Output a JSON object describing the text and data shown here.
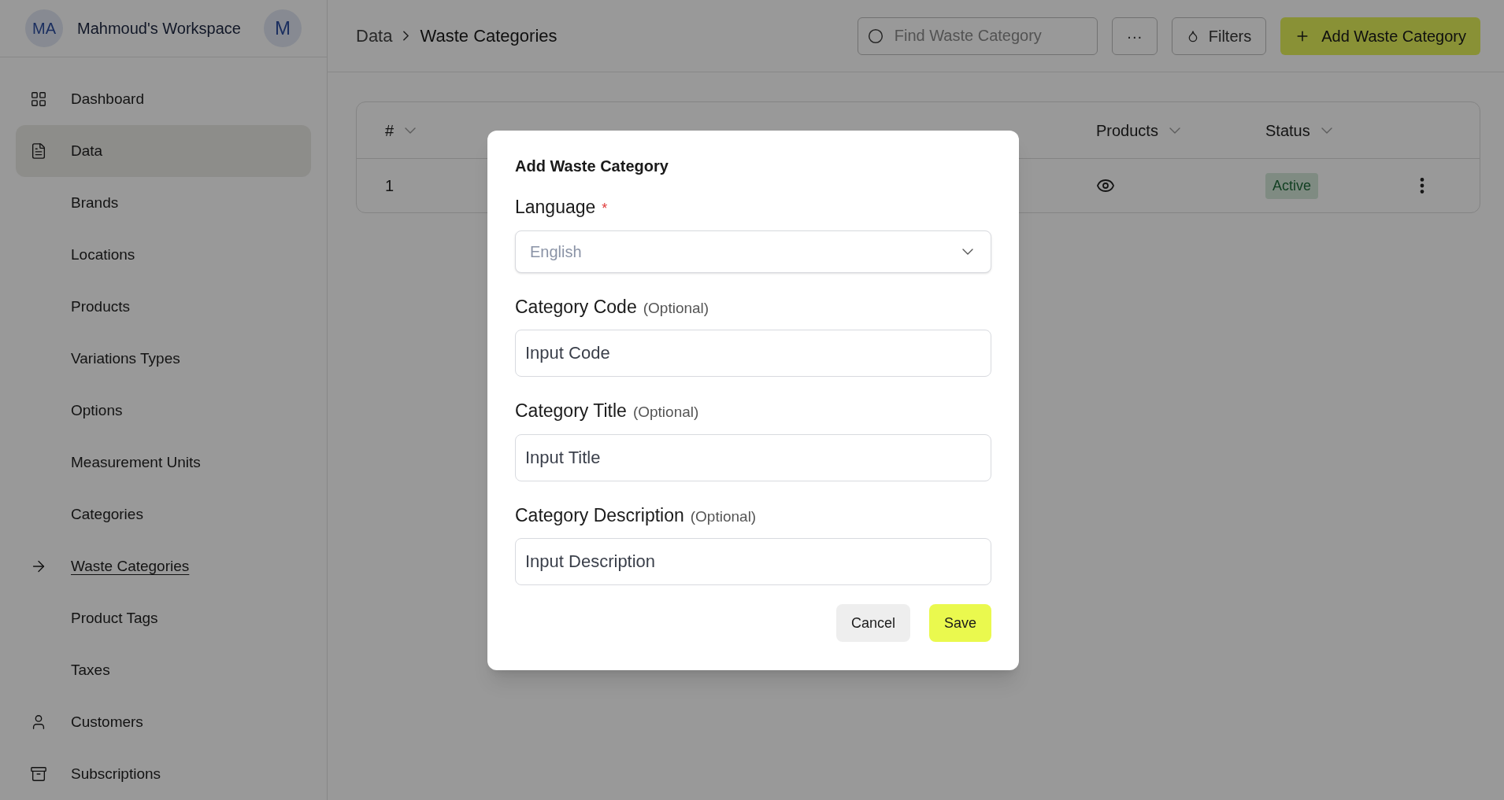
{
  "workspace": {
    "initials": "MA",
    "name": "Mahmoud's Workspace",
    "user_initial": "M"
  },
  "sidebar": {
    "items": [
      {
        "label": "Dashboard",
        "selected": false
      },
      {
        "label": "Data",
        "selected": true,
        "children": [
          {
            "label": "Brands",
            "selected": false
          },
          {
            "label": "Locations",
            "selected": false
          },
          {
            "label": "Products",
            "selected": false
          },
          {
            "label": "Variations Types",
            "selected": false
          },
          {
            "label": "Options",
            "selected": false
          },
          {
            "label": "Measurement Units",
            "selected": false
          },
          {
            "label": "Categories",
            "selected": false
          },
          {
            "label": "Waste Categories",
            "selected": true
          },
          {
            "label": "Product Tags",
            "selected": false
          },
          {
            "label": "Taxes",
            "selected": false
          }
        ]
      },
      {
        "label": "Customers",
        "selected": false
      },
      {
        "label": "Subscriptions",
        "selected": false
      }
    ]
  },
  "breadcrumb": [
    "Data",
    "Waste Categories"
  ],
  "search": {
    "placeholder": "Find Waste Category"
  },
  "toolbar": {
    "more": "···",
    "filters": "Filters",
    "add": "Add Waste Category"
  },
  "table": {
    "columns": [
      "#",
      "Products",
      "Status"
    ],
    "rows": [
      {
        "number": "1",
        "status": "Active"
      }
    ]
  },
  "dialog": {
    "title": "Add Waste Category",
    "fields": [
      {
        "kind": "select",
        "label": "Language",
        "required_mark": "*",
        "placeholder": "English"
      },
      {
        "kind": "text",
        "label": "Category Code",
        "note": "(Optional)",
        "placeholder": "Input Code"
      },
      {
        "kind": "text",
        "label": "Category Title",
        "note": "(Optional)",
        "placeholder": "Input Title"
      },
      {
        "kind": "text",
        "label": "Category Description",
        "note": "(Optional)",
        "placeholder": "Input Description"
      }
    ],
    "buttons": [
      {
        "kind": "secondary",
        "label": "Cancel"
      },
      {
        "kind": "primary",
        "label": "Save"
      }
    ]
  }
}
